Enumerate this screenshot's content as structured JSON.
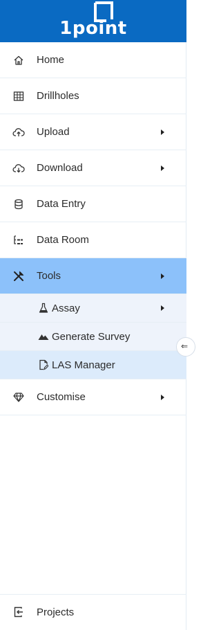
{
  "logo": {
    "text": "1point"
  },
  "menu": {
    "items": [
      {
        "label": "Home",
        "icon": "home-icon"
      },
      {
        "label": "Drillholes",
        "icon": "grid-icon"
      },
      {
        "label": "Upload",
        "icon": "cloud-upload-icon"
      },
      {
        "label": "Download",
        "icon": "cloud-download-icon"
      },
      {
        "label": "Data Entry",
        "icon": "database-icon"
      },
      {
        "label": "Data Room",
        "icon": "tree-structure-icon"
      },
      {
        "label": "Tools",
        "icon": "tools-icon"
      }
    ],
    "tools_sub": [
      {
        "label": "Assay",
        "icon": "flask-icon"
      },
      {
        "label": "Generate Survey",
        "icon": "mountain-icon"
      },
      {
        "label": "LAS Manager",
        "icon": "file-edit-icon"
      }
    ],
    "customise": {
      "label": "Customise",
      "icon": "gem-icon"
    }
  },
  "bottom": {
    "label": "Projects",
    "icon": "exit-icon"
  },
  "colors": {
    "brand": "#0a6ac2",
    "active": "#8cc1fa",
    "sub_bg": "#eef3fb",
    "sub_selected": "#dcebfb"
  }
}
